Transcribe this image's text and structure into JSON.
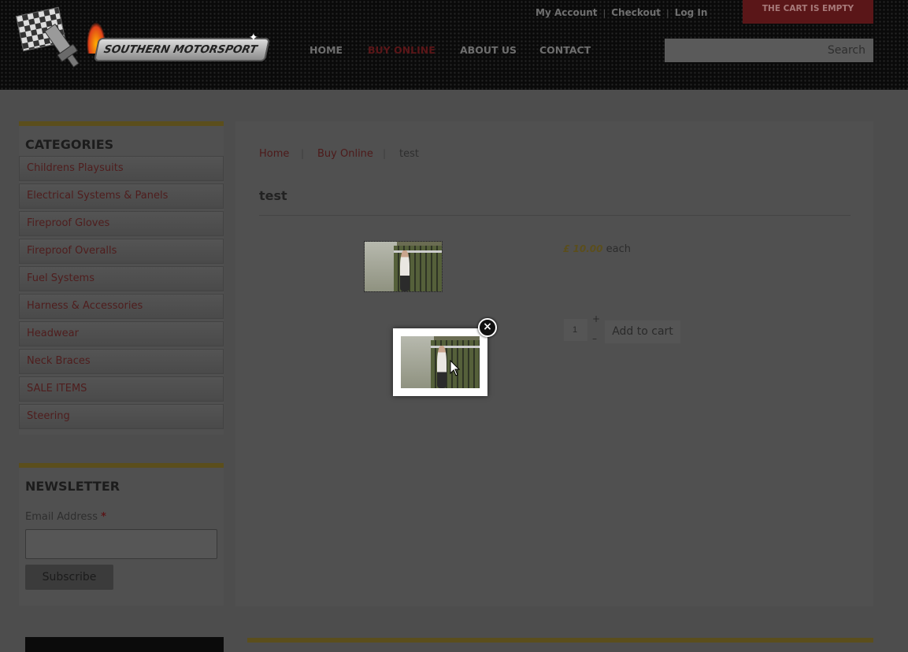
{
  "header": {
    "logo_text": "SOUTHERN MOTORSPORT",
    "top_links": [
      "My Account",
      "Checkout",
      "Log In"
    ],
    "top_link_separator": "|",
    "cart_label": "THE CART IS EMPTY",
    "nav": [
      {
        "label": "HOME",
        "active": false
      },
      {
        "label": "BUY ONLINE",
        "active": true
      },
      {
        "label": "ABOUT US",
        "active": false
      },
      {
        "label": "CONTACT",
        "active": false
      }
    ],
    "search_placeholder": "Search"
  },
  "sidebar": {
    "categories_title": "CATEGORIES",
    "categories": [
      "Childrens Playsuits",
      "Electrical Systems & Panels",
      "Fireproof Gloves",
      "Fireproof Overalls",
      "Fuel Systems",
      "Harness & Accessories",
      "Headwear",
      "Neck Braces",
      "SALE ITEMS",
      "Steering"
    ],
    "newsletter": {
      "title": "NEWSLETTER",
      "email_label": "Email Address",
      "required_mark": "*",
      "subscribe_label": "Subscribe"
    }
  },
  "breadcrumb": {
    "items": [
      "Home",
      "Buy Online",
      "test"
    ],
    "separator": "|"
  },
  "product": {
    "title": "test",
    "price": "£ 10.00",
    "price_unit": "each",
    "quantity": "1",
    "qty_plus": "+",
    "qty_minus": "–",
    "add_to_cart_label": "Add to cart"
  },
  "lightbox": {
    "close_symbol": "×"
  },
  "colors": {
    "accent_red": "#b3242a",
    "gold": "#b39a34",
    "overlay": "#4d4d4d"
  }
}
